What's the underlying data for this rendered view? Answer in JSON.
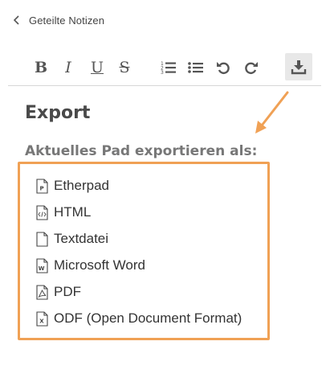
{
  "header": {
    "back_label": "Geteilte Notizen"
  },
  "toolbar": {
    "bold": "B",
    "italic": "I",
    "underline": "U",
    "strike": "S",
    "icons": [
      "ordered-list-icon",
      "bullet-list-icon",
      "undo-icon",
      "redo-icon",
      "export-icon"
    ]
  },
  "export": {
    "title": "Export",
    "subtitle": "Aktuelles Pad exportieren als:",
    "items": [
      {
        "label": "Etherpad",
        "icon": "etherpad-file-icon"
      },
      {
        "label": "HTML",
        "icon": "html-file-icon"
      },
      {
        "label": "Textdatei",
        "icon": "text-file-icon"
      },
      {
        "label": "Microsoft Word",
        "icon": "word-file-icon"
      },
      {
        "label": "PDF",
        "icon": "pdf-file-icon"
      },
      {
        "label": "ODF (Open Document Format)",
        "icon": "odf-file-icon"
      }
    ]
  },
  "colors": {
    "highlight": "#f0a155",
    "text": "#333333",
    "subtitle": "#777777"
  }
}
